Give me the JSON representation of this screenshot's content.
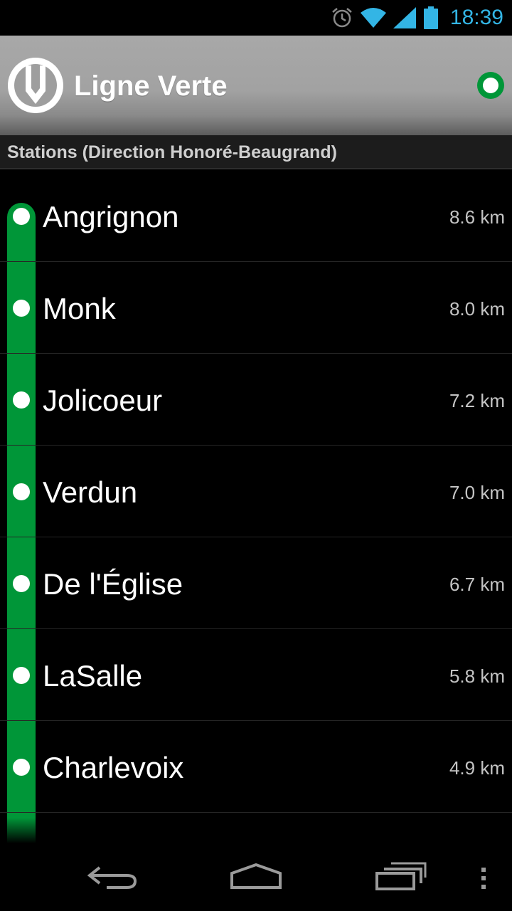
{
  "status_bar": {
    "time": "18:39",
    "icons": [
      "alarm-icon",
      "wifi-icon",
      "signal-icon",
      "battery-icon"
    ],
    "accent_color": "#33b5e5"
  },
  "header": {
    "logo_icon": "metro-logo-icon",
    "title": "Ligne Verte",
    "line_color": "#009638"
  },
  "section": {
    "title": "Stations (Direction Honoré-Beaugrand)"
  },
  "stations": [
    {
      "name": "Angrignon",
      "distance": "8.6 km"
    },
    {
      "name": "Monk",
      "distance": "8.0 km"
    },
    {
      "name": "Jolicoeur",
      "distance": "7.2 km"
    },
    {
      "name": "Verdun",
      "distance": "7.0 km"
    },
    {
      "name": "De l'Église",
      "distance": "6.7 km"
    },
    {
      "name": "LaSalle",
      "distance": "5.8 km"
    },
    {
      "name": "Charlevoix",
      "distance": "4.9 km"
    }
  ],
  "nav_bar": {
    "buttons": [
      "back-icon",
      "home-icon",
      "recent-apps-icon",
      "overflow-menu-icon"
    ]
  }
}
